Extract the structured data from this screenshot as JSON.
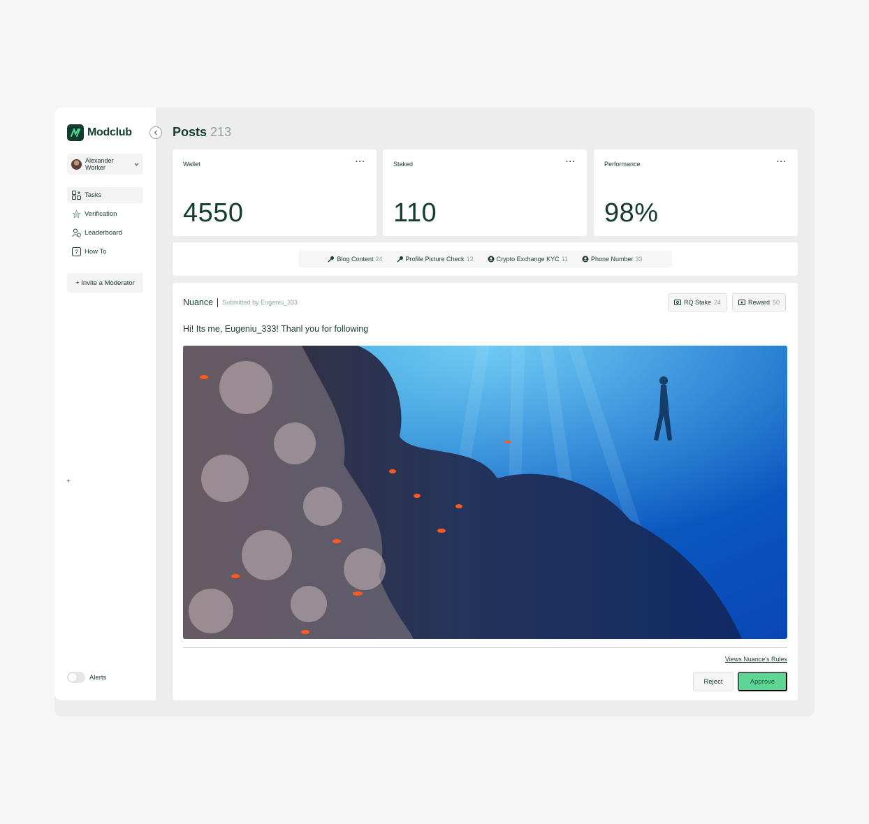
{
  "app": {
    "name": "Modclub"
  },
  "user": {
    "name": "Alexander Worker"
  },
  "sidebar": {
    "items": [
      {
        "label": "Tasks",
        "icon": "tasks-icon"
      },
      {
        "label": "Verification",
        "icon": "verification-icon"
      },
      {
        "label": "Leaderboard",
        "icon": "leaderboard-icon"
      },
      {
        "label": "How To",
        "icon": "help-icon"
      }
    ],
    "invite_label": "+ Invite a Moderator",
    "plus_label": "+",
    "alerts_label": "Alerts"
  },
  "header": {
    "title": "Posts",
    "count": "213"
  },
  "stats": [
    {
      "label": "Wallet",
      "value": "4550"
    },
    {
      "label": "Staked",
      "value": "110"
    },
    {
      "label": "Performance",
      "value": "98%"
    }
  ],
  "filters": [
    {
      "label": "Blog Content",
      "count": "24",
      "icon": "key-icon"
    },
    {
      "label": "Profile Picture Check",
      "count": "12",
      "icon": "key-icon"
    },
    {
      "label": "Crypto Exchange KYC",
      "count": "11",
      "icon": "user-circle-icon"
    },
    {
      "label": "Phone Number",
      "count": "33",
      "icon": "user-circle-icon"
    }
  ],
  "post": {
    "source": "Nuance",
    "submitted_by": "Submitted by Eugeniu_333",
    "stake_label": "RQ Stake",
    "stake_value": "24",
    "reward_label": "Reward",
    "reward_value": "50",
    "text": "Hi! Its me, Eugeniu_333! Thanl you for following",
    "rules_link": "Views Nuance's Rules",
    "reject_label": "Reject",
    "approve_label": "Approve"
  },
  "colors": {
    "brand": "#133c2f",
    "approve": "#5fd595",
    "muted": "#8fa39c"
  }
}
